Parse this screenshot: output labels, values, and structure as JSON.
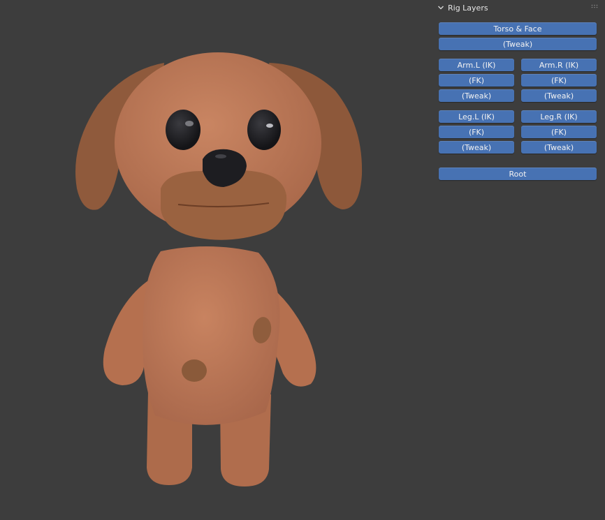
{
  "panel": {
    "title": "Rig Layers",
    "collapse_icon": "chevron-down-icon",
    "drag_icon": "grip-icon"
  },
  "buttons": {
    "torso_face": "Torso & Face",
    "torso_tweak": "(Tweak)",
    "arm_l_ik": "Arm.L (IK)",
    "arm_r_ik": "Arm.R (IK)",
    "arm_l_fk": "(FK)",
    "arm_r_fk": "(FK)",
    "arm_l_tweak": "(Tweak)",
    "arm_r_tweak": "(Tweak)",
    "leg_l_ik": "Leg.L (IK)",
    "leg_r_ik": "Leg.R (IK)",
    "leg_l_fk": "(FK)",
    "leg_r_fk": "(FK)",
    "leg_l_tweak": "(Tweak)",
    "leg_r_tweak": "(Tweak)",
    "root": "Root"
  },
  "colors": {
    "viewport_bg": "#3d3d3d",
    "button_active": "#4772b3",
    "dog_body": "#c07a55",
    "dog_ear": "#8f5a3c",
    "dog_muzzle": "#9a6240",
    "dog_spot": "#8a5a3a"
  }
}
